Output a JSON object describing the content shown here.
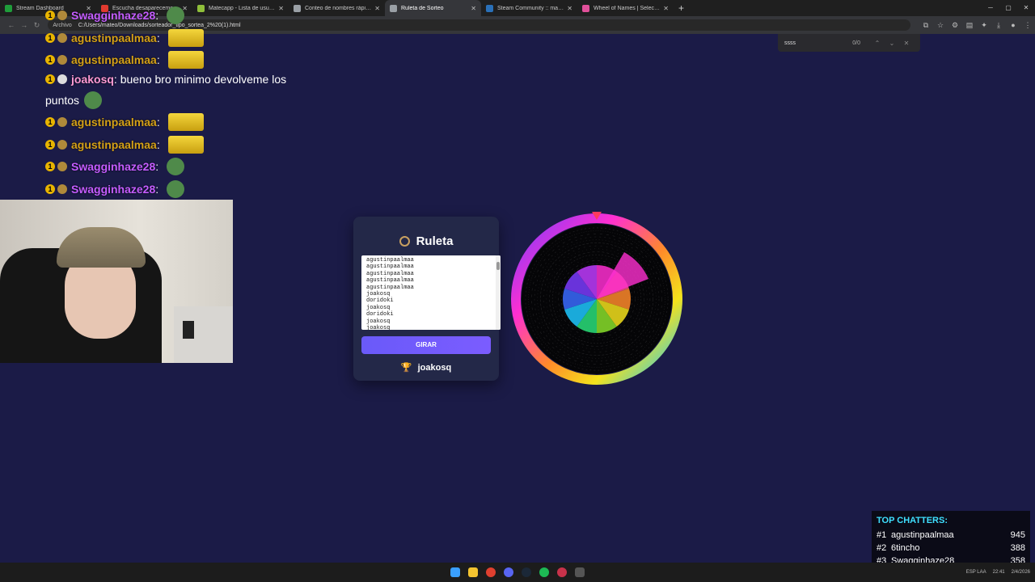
{
  "browser": {
    "tabs": [
      {
        "label": "Stream Dashboard",
        "color": "#1f9d3a"
      },
      {
        "label": "Escucha desaparecemos de...",
        "color": "#e03a2f"
      },
      {
        "label": "Matecapp - Lista de usuarios d...",
        "color": "#8fbf3a"
      },
      {
        "label": "Conteo de nombres rápido",
        "color": "#9aa0a6"
      },
      {
        "label": "Ruleta de Sorteo",
        "color": "#9aa0a6",
        "active": true
      },
      {
        "label": "Steam Community :: mate :: ltz...",
        "color": "#2a70b8"
      },
      {
        "label": "Wheel of Names | Selector de...",
        "color": "#e0509a"
      }
    ],
    "address_chip": "Archivo",
    "url": "C:/Users/mateo/Downloads/sorteador_tipo_sortea_2%20(1).html",
    "find": {
      "query": "ssss",
      "count": "0/0"
    }
  },
  "chat": [
    {
      "user": "Swagginhaze28",
      "user_color": "#c45cff",
      "badge": "1",
      "emote": "pepe"
    },
    {
      "user": "agustinpaalmaa",
      "user_color": "#d4a017",
      "badge": "1",
      "emote": "minion"
    },
    {
      "user": "agustinpaalmaa",
      "user_color": "#d4a017",
      "badge": "1",
      "emote": "minion"
    },
    {
      "user": "joakosq",
      "user_color": "#ff9ad5",
      "badge": "1",
      "message": "bueno bro minimo devolveme los",
      "message2": "puntos",
      "emote": "pepe"
    },
    {
      "user": "agustinpaalmaa",
      "user_color": "#d4a017",
      "badge": "1",
      "emote": "minion"
    },
    {
      "user": "agustinpaalmaa",
      "user_color": "#d4a017",
      "badge": "1",
      "emote": "minion"
    },
    {
      "user": "Swagginhaze28",
      "user_color": "#c45cff",
      "badge": "1",
      "emote": "pepe"
    },
    {
      "user": "Swagginhaze28",
      "user_color": "#c45cff",
      "badge": "1",
      "emote": "pepe"
    }
  ],
  "panel": {
    "title": "Ruleta",
    "names": [
      "agustinpaalmaa",
      "agustinpaalmaa",
      "agustinpaalmaa",
      "agustinpaalmaa",
      "agustinpaalmaa",
      "joakosq",
      "doridoki",
      "joakosq",
      "doridoki",
      "joakosq",
      "joakosq"
    ],
    "spin_label": "GIRAR",
    "winner": "joakosq"
  },
  "top_chatters": {
    "title": "TOP CHATTERS:",
    "rows": [
      {
        "rank": "#1",
        "name": "agustinpaalmaa",
        "count": "945"
      },
      {
        "rank": "#2",
        "name": "6tincho",
        "count": "388"
      },
      {
        "rank": "#3",
        "name": "Swagginhaze28",
        "count": "358"
      }
    ]
  },
  "taskbar": {
    "lang": "ESP\nLAA",
    "time": "22:41",
    "date": "2/4/2026"
  }
}
